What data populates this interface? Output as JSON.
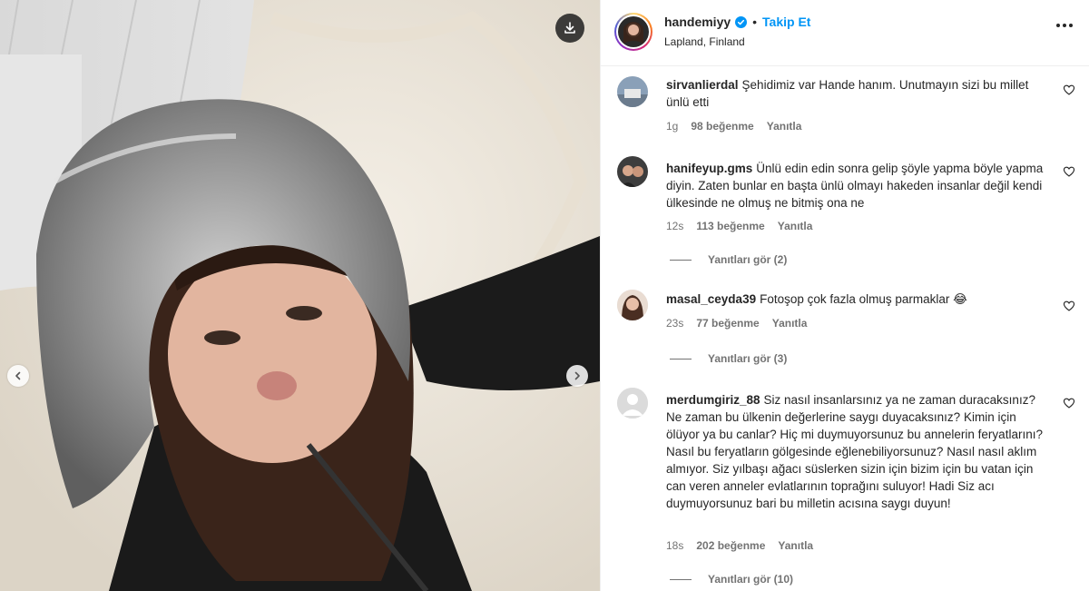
{
  "post": {
    "username": "handemiyy",
    "follow_label": "Takip Et",
    "dot": "•",
    "location": "Lapland, Finland"
  },
  "icons": {
    "download": "download-icon",
    "more": "more-options-icon",
    "verified": "verified-badge-icon",
    "heart": "heart-icon",
    "prev": "chevron-left-icon",
    "next": "chevron-right-icon"
  },
  "colors": {
    "accent": "#0095f6",
    "verified": "#0095f6",
    "muted": "#737373"
  },
  "comments": [
    {
      "username": "sirvanlierdal",
      "text": "Şehidimiz var Hande hanım. Unutmayın sizi bu millet ünlü etti",
      "time": "1g",
      "likes": "98 beğenme",
      "reply": "Yanıtla"
    },
    {
      "username": "hanifeyup.gms",
      "text": "Ünlü edin edin sonra gelip şöyle yapma böyle yapma diyin. Zaten bunlar en başta ünlü olmayı hakeden insanlar değil kendi ülkesinde ne olmuş ne bitmiş ona ne",
      "time": "12s",
      "likes": "113 beğenme",
      "reply": "Yanıtla",
      "view_replies": "Yanıtları gör (2)"
    },
    {
      "username": "masal_ceyda39",
      "text": "Fotoşop çok fazla olmuş parmaklar 😂",
      "time": "23s",
      "likes": "77 beğenme",
      "reply": "Yanıtla",
      "view_replies": "Yanıtları gör (3)"
    },
    {
      "username": "merdumgiriz_88",
      "text": "Siz nasıl insanlarsınız ya ne zaman duracaksınız? Ne zaman bu ülkenin değerlerine saygı duyacaksınız? Kimin için ölüyor ya bu canlar? Hiç mi duymuyorsunuz bu annelerin feryatlarını? Nasıl bu feryatların gölgesinde eğlenebiliyorsunuz? Nasıl nasıl aklım almıyor. Siz yılbaşı ağacı süslerken sizin için bizim için bu vatan için can veren anneler evlatlarının toprağını suluyor! Hadi Siz acı duymuyorsunuz bari bu milletin acısına saygı duyun!",
      "time": "18s",
      "likes": "202 beğenme",
      "reply": "Yanıtla",
      "view_replies": "Yanıtları gör (10)"
    }
  ]
}
